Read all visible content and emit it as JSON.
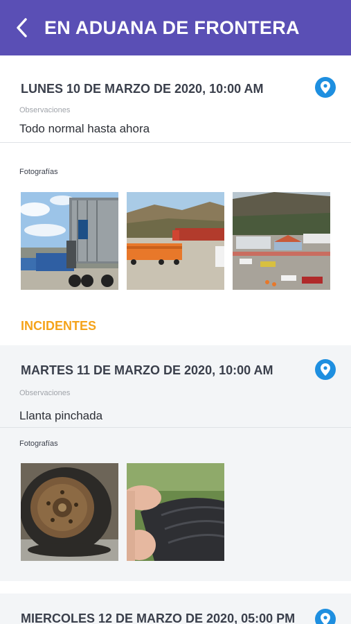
{
  "header": {
    "title": "EN ADUANA DE FRONTERA",
    "back_icon": "chevron-left-icon"
  },
  "entries": [
    {
      "date": "LUNES 10 DE MARZO DE 2020, 10:00 AM",
      "observations_label": "Observaciones",
      "observations": "Todo normal hasta ahora",
      "photos_label": "Fotografías",
      "photos": [
        "container-truck-photo",
        "orange-cargo-trucks-photo",
        "border-checkpoint-photo"
      ]
    },
    {
      "date": "MARTES 11 DE MARZO DE 2020, 10:00 AM",
      "observations_label": "Observaciones",
      "observations": "Llanta pinchada",
      "photos_label": "Fotografías",
      "photos": [
        "flat-tire-photo",
        "punctured-tire-closeup-photo"
      ]
    },
    {
      "date": "MIERCOLES 12 DE MARZO DE 2020, 05:00 PM"
    }
  ],
  "incidents_heading": "INCIDENTES",
  "colors": {
    "header_bg": "#5a4fb5",
    "pin": "#1e8fe0",
    "incidents": "#f5a31a",
    "incident_card_bg": "#f3f5f7"
  }
}
